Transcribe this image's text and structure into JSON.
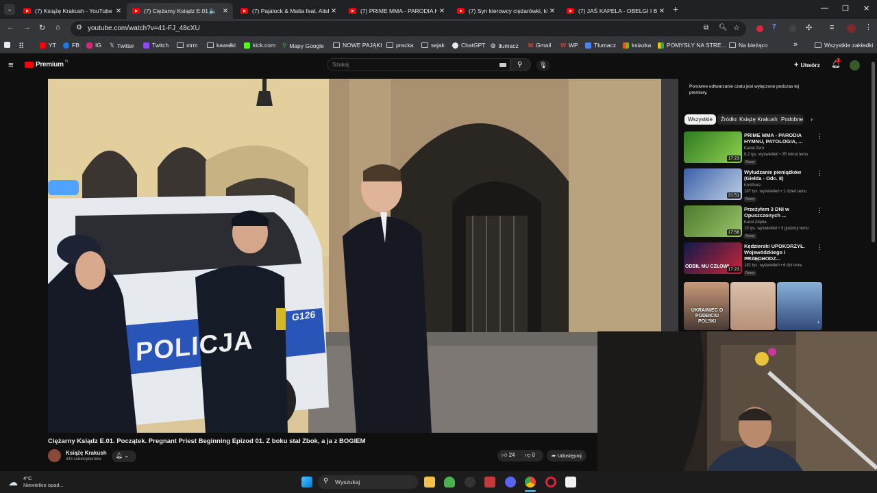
{
  "browser": {
    "tabs": [
      {
        "title": "(7) Książę Krakush - YouTube",
        "active": false
      },
      {
        "title": "(7) Ciężarny Ksiądz E.01. Po",
        "active": true
      },
      {
        "title": "(7) Pajalock & Malta feat. Alish",
        "active": false
      },
      {
        "title": "(7) PRIME MMA - PARODIA HY",
        "active": false
      },
      {
        "title": "(7) Syn kierowcy ciężarówki, kt",
        "active": false
      },
      {
        "title": "(7) JAŚ KAPELA - OBELGI I BLU",
        "active": false
      }
    ],
    "new_tab": "+",
    "url": "youtube.com/watch?v=41-FJ_48cXU",
    "bookmarks": [
      "YT",
      "FB",
      "IG",
      "Twitter",
      "Twitch",
      "strm",
      "kawałki",
      "kick.com",
      "Mapy Google",
      "NOWE PAJĄKI",
      "pracka",
      "sejak",
      "ChatGPT",
      "tłumacz",
      "Gmail",
      "WP",
      "Tłumacz",
      "ksiazka",
      "POMYSŁY NA STRE...",
      "Na bieżąco"
    ],
    "bookmarks_more": "»",
    "all_bookmarks": "Wszystkie zakładki"
  },
  "youtube": {
    "logo": "Premium",
    "logo_region": "PL",
    "search_placeholder": "Szukaj",
    "create_label": "Utwórz",
    "notif_count": "7",
    "video_title": "Ciężarny Ksiądz E.01. Początek. Pregnant Priest Beginning Epizod 01. Z boku stał Zbok, a ja z BOGIEM",
    "channel_name": "Książę Krakush",
    "subscribers": "443 subskrybentów",
    "likes": "24",
    "dislikes": "0",
    "share_label": "Udostępnij",
    "police_sign": "POLICJA",
    "police_number": "G126",
    "chat_notice": "Ponowne odtwarzanie czatu jest wyłączone podczas tej premiery.",
    "chips": [
      "Wszystkie",
      "Źródło: Książę Krakush",
      "Podobne"
    ],
    "recommendations": [
      {
        "title": "PRIME MMA - PARODIA HYMNU, PATOLOGIA, ...",
        "channel": "Kanał Zero",
        "meta": "8,2 tys. wyświetleń • 35 minut temu",
        "badge": "Nowy",
        "duration": "17:23",
        "thumb_color": "#3c8a2e"
      },
      {
        "title": "Wyłudzanie pieniążków (Giełda - Odc. 8)",
        "channel": "Konfitura",
        "meta": "187 tys. wyświetleń • 1 dzień temu",
        "badge": "Nowy",
        "duration": "31:51",
        "thumb_color": "#4a6fb0"
      },
      {
        "title": "Przeżyłem 3 DNI w Opuszczonych ...",
        "channel": "Karol Zdęba",
        "meta": "15 tys. wyświetleń • 3 godziny temu",
        "badge": "Nowy",
        "duration": "17:58",
        "thumb_color": "#5a8a3a"
      },
      {
        "title": "Kędzierski UPOKORZYŁ. Wojewódzkiego i PRZECHODZ...",
        "channel": "Kto Wygrał",
        "meta": "182 tys. wyświetleń • 6 dni temu",
        "badge": "Nowy",
        "duration": "17:23",
        "thumb_color": "#1a2a6a"
      }
    ],
    "rec4_overlay": "ODBIŁ MU CZŁOWI",
    "shorts_overlay": "UKRAINIEC O PODBICIU POLSKI"
  },
  "taskbar": {
    "temperature": "4°C",
    "weather": "Niewielkie opad...",
    "search_label": "Wyszukaj"
  },
  "colors": {
    "yt_red": "#ff0000",
    "bg": "#0f0f0f",
    "browser_tab": "#35363a"
  }
}
